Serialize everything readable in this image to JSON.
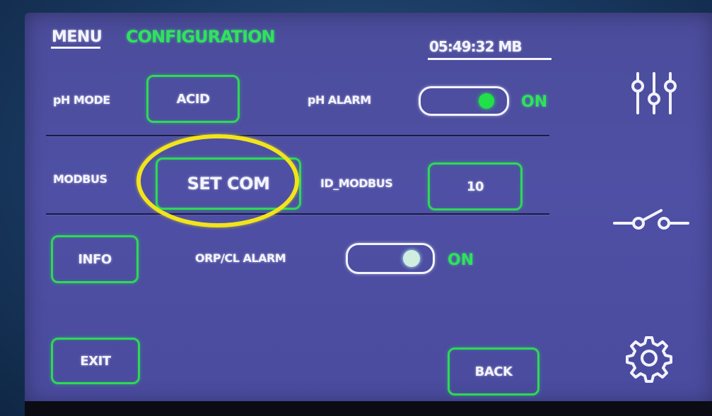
{
  "header": {
    "menu_label": "MENU",
    "title": "CONFIGURATION",
    "clock": "05:49:32 MB"
  },
  "row1": {
    "ph_mode_label": "pH MODE",
    "ph_mode_value": "ACID",
    "ph_alarm_label": "pH ALARM",
    "ph_alarm_state": "ON"
  },
  "row2": {
    "modbus_label": "MODBUS",
    "set_com_label": "SET COM",
    "id_modbus_label": "ID_MODBUS",
    "id_modbus_value": "10"
  },
  "row3": {
    "info_label": "INFO",
    "orp_alarm_label": "ORP/CL ALARM",
    "orp_alarm_state": "ON"
  },
  "footer": {
    "exit_label": "EXIT",
    "back_label": "BACK"
  },
  "sidebar": {
    "icons": [
      "sliders-icon",
      "switch-icon",
      "gear-icon"
    ]
  },
  "colors": {
    "screen": "#4f50a5",
    "accent_green": "#2fe35a",
    "highlight_yellow": "#f2e41a"
  }
}
